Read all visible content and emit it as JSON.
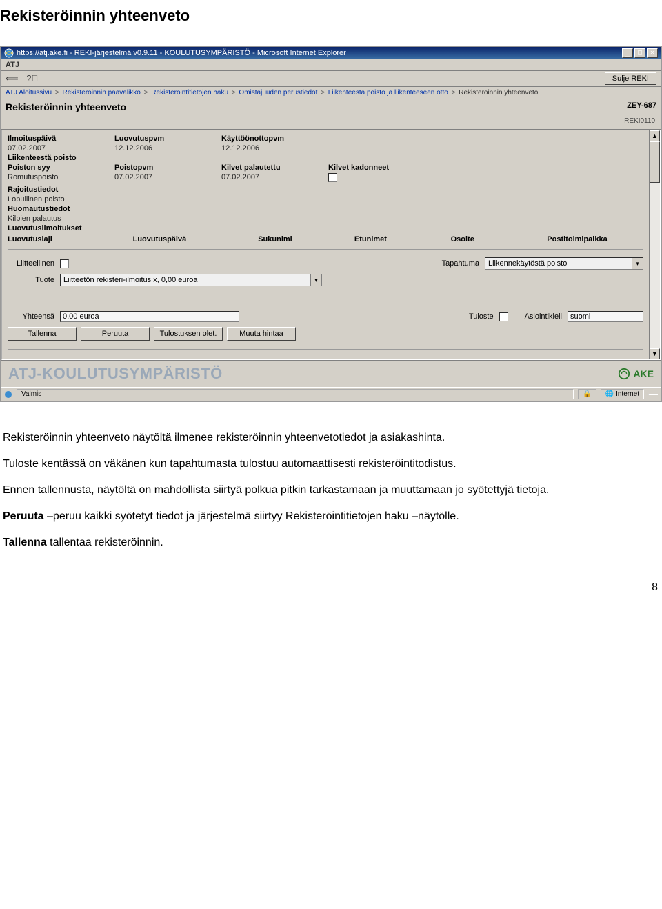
{
  "doc_title": "Rekisteröinnin yhteenveto",
  "ie": {
    "title": "https://atj.ake.fi - REKI-järjestelmä v0.9.11 - KOULUTUSYMPÄRISTÖ - Microsoft Internet Explorer",
    "status_ready": "Valmis",
    "status_zone": "Internet"
  },
  "app": {
    "atj_label": "ATJ",
    "close_btn": "Sulje REKI"
  },
  "breadcrumb": [
    "ATJ Aloitussivu",
    "Rekisteröinnin päävalikko",
    "Rekisteröintitietojen haku",
    "Omistajuuden perustiedot",
    "Liikenteestä poisto ja liikenteeseen otto",
    "Rekisteröinnin yhteenveto"
  ],
  "header": {
    "title": "Rekisteröinnin yhteenveto",
    "plate": "ZEY-687",
    "ref": "REKI0110"
  },
  "fields": {
    "ilmoituspaiva_lbl": "Ilmoituspäivä",
    "ilmoituspaiva_val": "07.02.2007",
    "luovutuspvm_lbl": "Luovutuspvm",
    "luovutuspvm_val": "12.12.2006",
    "kayttoonottopvm_lbl": "Käyttöönottopvm",
    "kayttoonottopvm_val": "12.12.2006",
    "liikenteesta_poisto_lbl": "Liikenteestä poisto",
    "poiston_syy_lbl": "Poiston syy",
    "poiston_syy_val": "Romutuspoisto",
    "poistopvm_lbl": "Poistopvm",
    "poistopvm_val": "07.02.2007",
    "kilvet_palautettu_lbl": "Kilvet palautettu",
    "kilvet_palautettu_val": "07.02.2007",
    "kilvet_kadonneet_lbl": "Kilvet kadonneet",
    "rajoitustiedot_lbl": "Rajoitustiedot",
    "lopullinen_poisto_val": "Lopullinen poisto",
    "huomautustiedot_lbl": "Huomautustiedot",
    "kilpien_palautus_val": "Kilpien palautus",
    "luovutusilmoitukset_lbl": "Luovutusilmoitukset"
  },
  "cols": {
    "luovutuslaji": "Luovutuslaji",
    "luovutuspaiva": "Luovutuspäivä",
    "sukunimi": "Sukunimi",
    "etunimet": "Etunimet",
    "osoite": "Osoite",
    "postitoimipaikka": "Postitoimipaikka"
  },
  "form": {
    "liitteellinen_lbl": "Liitteellinen",
    "tapahtuma_lbl": "Tapahtuma",
    "tapahtuma_val": "Liikennekäytöstä poisto",
    "tuote_lbl": "Tuote",
    "tuote_val": "Liitteetön rekisteri-ilmoitus x, 0,00 euroa",
    "yhteensa_lbl": "Yhteensä",
    "yhteensa_val": "0,00 euroa",
    "tuloste_lbl": "Tuloste",
    "asiointikieli_lbl": "Asiointikieli",
    "asiointikieli_val": "suomi"
  },
  "buttons": {
    "tallenna": "Tallenna",
    "peruuta": "Peruuta",
    "tulostuksen": "Tulostuksen olet.",
    "muuta": "Muuta hintaa"
  },
  "banner": {
    "text": "ATJ-KOULUTUSYMPÄRISTÖ",
    "logo": "AKE"
  },
  "doc_body": {
    "p1": "Rekisteröinnin yhteenveto näytöltä ilmenee rekisteröinnin yhteenvetotiedot ja asiakashinta.",
    "p2": "Tuloste kentässä on väkänen kun tapahtumasta tulostuu automaattisesti rekisteröintitodistus.",
    "p3": "Ennen tallennusta, näytöltä on mahdollista siirtyä polkua pitkin tarkastamaan ja muuttamaan jo syötettyjä tietoja.",
    "p4_b": "Peruuta ",
    "p4": "–peruu kaikki syötetyt tiedot ja järjestelmä siirtyy Rekisteröintitietojen haku –näytölle.",
    "p5_b": "Tallenna ",
    "p5": "tallentaa rekisteröinnin."
  },
  "page_num": "8"
}
